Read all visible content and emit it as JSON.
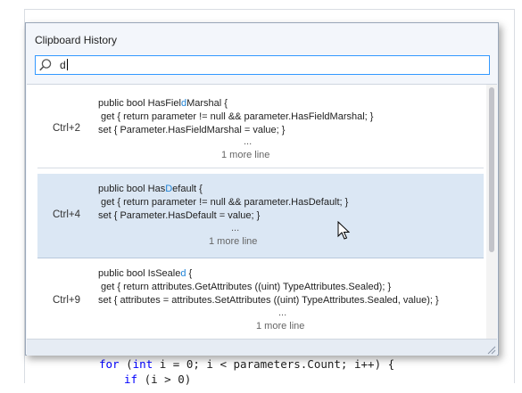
{
  "editor": {
    "code_line_1_kw": "for",
    "code_line_1_a": " (",
    "code_line_1_kw2": "int",
    "code_line_1_b": " i = 0; i < parameters.Count; i++) {",
    "code_line_2_kw": "if",
    "code_line_2_b": " (i > 0)"
  },
  "popup": {
    "title": "Clipboard History",
    "search": {
      "value": "d",
      "icon": "search-icon"
    },
    "items": [
      {
        "shortcut": "Ctrl+2",
        "line1_pre": "public bool HasFiel",
        "line1_hl": "d",
        "line1_post": "Marshal {",
        "line2": " get { return parameter != null && parameter.HasFieldMarshal; }",
        "line3": "set { Parameter.HasFieldMarshal = value; }",
        "ellipsis": "...",
        "more": "1 more line",
        "selected": false
      },
      {
        "shortcut": "Ctrl+4",
        "line1_pre": "public bool Has",
        "line1_hl": "D",
        "line1_post": "efault {",
        "line2": " get { return parameter != null && parameter.HasDefault; }",
        "line3": "set { Parameter.HasDefault = value; }",
        "ellipsis": "...",
        "more": "1 more line",
        "selected": true
      },
      {
        "shortcut": "Ctrl+9",
        "line1_pre": "public bool IsSeale",
        "line1_hl": "d",
        "line1_post": " {",
        "line2": " get { return attributes.GetAttributes ((uint) TypeAttributes.Sealed); }",
        "line3": "set { attributes = attributes.SetAttributes ((uint) TypeAttributes.Sealed, value); }",
        "ellipsis": "...",
        "more": "1 more line",
        "selected": false
      }
    ]
  },
  "colors": {
    "accent": "#3399ff",
    "match_highlight": "#1e82d6",
    "selected_row": "#dbe7f4",
    "keyword": "#0000ff"
  }
}
